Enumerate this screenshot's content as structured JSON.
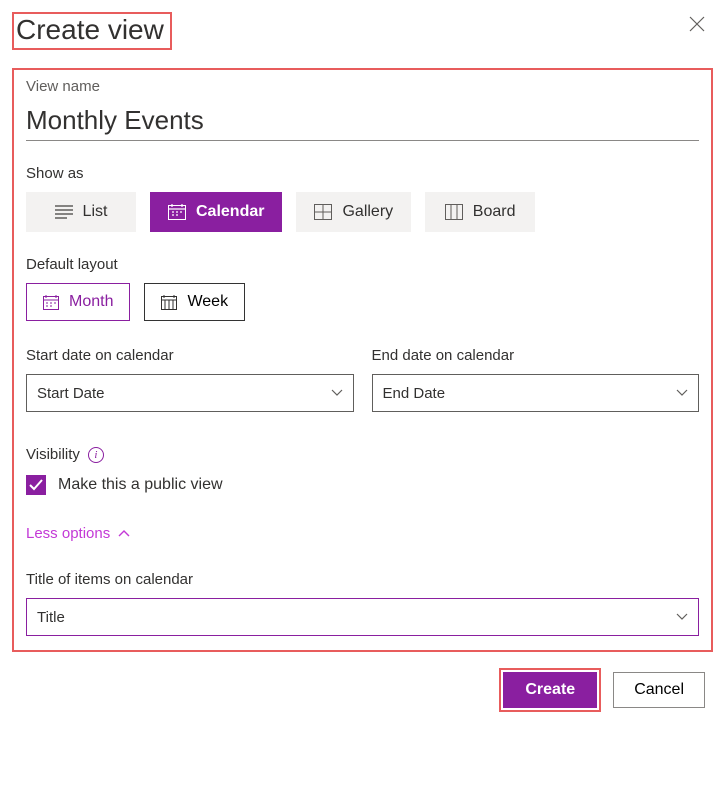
{
  "dialog": {
    "title": "Create view"
  },
  "fields": {
    "view_name_label": "View name",
    "view_name_value": "Monthly Events",
    "show_as_label": "Show as",
    "show_as_options": {
      "list": "List",
      "calendar": "Calendar",
      "gallery": "Gallery",
      "board": "Board"
    },
    "default_layout_label": "Default layout",
    "layout_options": {
      "month": "Month",
      "week": "Week"
    },
    "start_date_label": "Start date on calendar",
    "start_date_value": "Start Date",
    "end_date_label": "End date on calendar",
    "end_date_value": "End Date",
    "visibility_label": "Visibility",
    "public_view_label": "Make this a public view",
    "less_options_label": "Less options",
    "title_items_label": "Title of items on calendar",
    "title_items_value": "Title"
  },
  "footer": {
    "create_label": "Create",
    "cancel_label": "Cancel"
  },
  "state": {
    "show_as_selected": "calendar",
    "layout_selected": "month",
    "public_checked": true
  },
  "colors": {
    "accent": "#8a1fa0",
    "highlight_border": "#e85c5c"
  }
}
